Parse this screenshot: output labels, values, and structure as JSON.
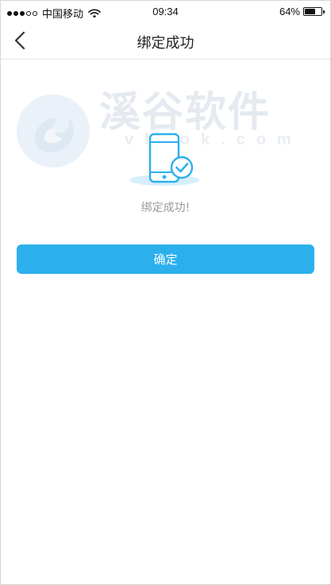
{
  "status_bar": {
    "carrier": "中国移动",
    "time": "09:34",
    "battery": "64%",
    "battery_level": 0.64
  },
  "nav": {
    "title": "绑定成功"
  },
  "watermark": {
    "brand_cn": "溪谷软件",
    "brand_en": "vlsok.com"
  },
  "content": {
    "success_message": "绑定成功!",
    "confirm_label": "确定"
  },
  "colors": {
    "accent": "#2bb0ec",
    "message_gray": "#9a9a9a"
  },
  "icons": {
    "back": "chevron-left-icon",
    "illustration": "phone-check-icon",
    "wifi": "wifi-icon",
    "battery": "battery-icon"
  }
}
